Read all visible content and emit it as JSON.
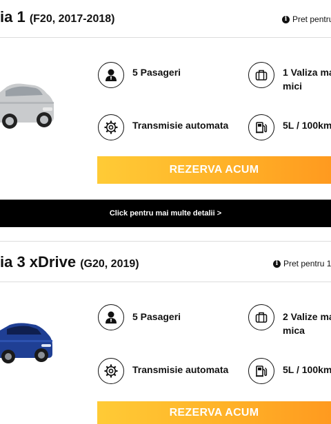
{
  "cars": [
    {
      "name": "ia 1",
      "generation": "(F20, 2017-2018)",
      "price_label": "Pret pentru",
      "passengers": "5 Pasageri",
      "luggage_line1": "1 Valiza ma",
      "luggage_line2": "mici",
      "transmission": "Transmisie automata",
      "fuel": "5L / 100km",
      "cta": "REZERVA ACUM",
      "car_color": "#c9cbcd"
    },
    {
      "name": "ia 3 xDrive",
      "generation": "(G20, 2019)",
      "price_label": "Pret pentru 1",
      "passengers": "5 Pasageri",
      "luggage_line1": "2 Valize ma",
      "luggage_line2": "mica",
      "transmission": "Transmisie automata",
      "fuel": "5L / 100km",
      "cta": "REZERVA ACUM",
      "car_color": "#1f3f94"
    }
  ],
  "details_bar": {
    "label": "Click pentru mai multe detalii >"
  },
  "colors": {
    "accent_start": "#ffcb36",
    "accent_end": "#ff9a1f",
    "details_bg": "#000000"
  }
}
